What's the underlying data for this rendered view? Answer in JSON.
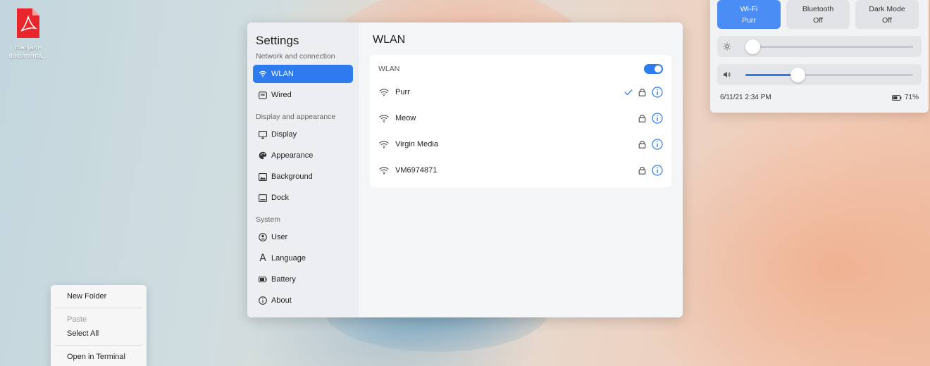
{
  "desktop": {
    "icon_label_line1": "manjaro-",
    "icon_label_line2": "documenta..."
  },
  "settings": {
    "title": "Settings",
    "sections": [
      {
        "label": "Network and connection",
        "items": [
          {
            "label": "WLAN",
            "icon": "wifi-icon",
            "active": true
          },
          {
            "label": "Wired",
            "icon": "ethernet-icon",
            "active": false
          }
        ]
      },
      {
        "label": "Display and appearance",
        "items": [
          {
            "label": "Display",
            "icon": "monitor-icon"
          },
          {
            "label": "Appearance",
            "icon": "palette-icon"
          },
          {
            "label": "Background",
            "icon": "image-icon"
          },
          {
            "label": "Dock",
            "icon": "dock-icon"
          }
        ]
      },
      {
        "label": "System",
        "items": [
          {
            "label": "User",
            "icon": "user-icon"
          },
          {
            "label": "Language",
            "icon": "language-icon"
          },
          {
            "label": "Battery",
            "icon": "battery-icon"
          },
          {
            "label": "About",
            "icon": "info-icon"
          }
        ]
      }
    ],
    "main_title": "WLAN",
    "wlan_card_label": "WLAN",
    "wlan_enabled": true,
    "networks": [
      {
        "name": "Purr",
        "connected": true,
        "secured": true
      },
      {
        "name": "Meow",
        "connected": false,
        "secured": true
      },
      {
        "name": "Virgin Media",
        "connected": false,
        "secured": true
      },
      {
        "name": "VM6974871",
        "connected": false,
        "secured": true
      }
    ]
  },
  "context_menu": {
    "new_folder": "New Folder",
    "paste": "Paste",
    "select_all": "Select All",
    "open_terminal": "Open in Terminal"
  },
  "quick_settings": {
    "tiles": [
      {
        "title": "Wi-Fi",
        "state": "Purr",
        "on": true
      },
      {
        "title": "Bluetooth",
        "state": "Off",
        "on": false
      },
      {
        "title": "Dark Mode",
        "state": "Off",
        "on": false
      }
    ],
    "brightness_level": 0.0,
    "volume_level": 0.31,
    "datetime": "6/11/21 2:34 PM",
    "battery": "71%"
  },
  "colors": {
    "accent": "#2e7bf0",
    "tile_on": "#4a8df5"
  }
}
